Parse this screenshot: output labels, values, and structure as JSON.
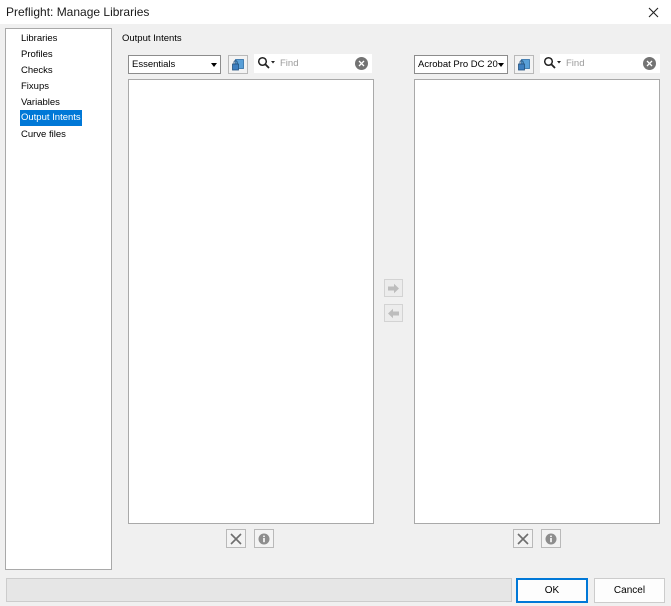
{
  "window": {
    "title": "Preflight: Manage Libraries"
  },
  "sidebar": {
    "items": [
      {
        "label": "Libraries",
        "selected": false
      },
      {
        "label": "Profiles",
        "selected": false
      },
      {
        "label": "Checks",
        "selected": false
      },
      {
        "label": "Fixups",
        "selected": false
      },
      {
        "label": "Variables",
        "selected": false
      },
      {
        "label": "Output Intents",
        "selected": true
      },
      {
        "label": "Curve files",
        "selected": false
      }
    ]
  },
  "main": {
    "section_title": "Output Intents",
    "left_panel": {
      "library_select": "Essentials",
      "search": {
        "placeholder": "Find"
      }
    },
    "right_panel": {
      "library_select": "Acrobat Pro DC 20",
      "search": {
        "placeholder": "Find"
      }
    }
  },
  "footer": {
    "ok_label": "OK",
    "cancel_label": "Cancel"
  },
  "colors": {
    "selection": "#0078d7",
    "dialog_bg": "#f0f0f0"
  }
}
